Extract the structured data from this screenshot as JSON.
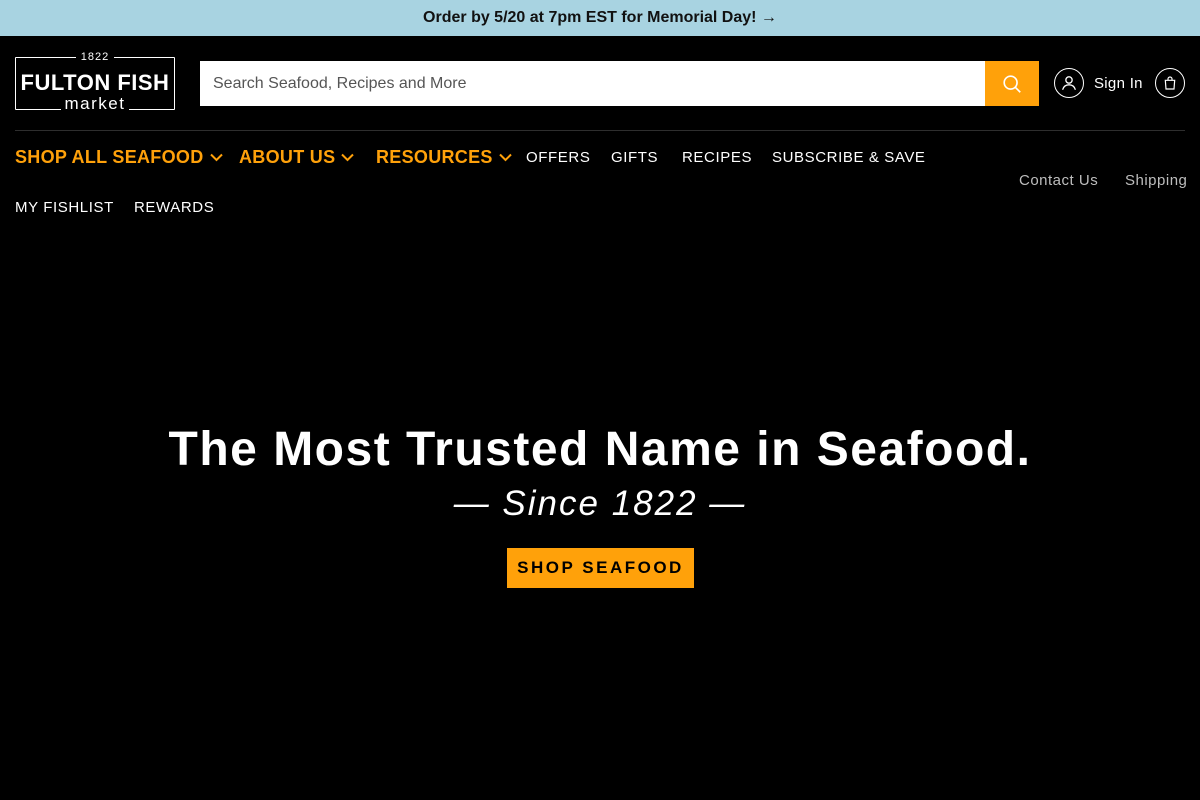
{
  "promo": {
    "text": "Order by 5/20 at 7pm EST for Memorial Day! →"
  },
  "logo": {
    "year": "1822",
    "name": "FULTON FISH",
    "sub": "market"
  },
  "search": {
    "placeholder": "Search Seafood, Recipes and More",
    "value": ""
  },
  "account": {
    "sign_in_label": "Sign In"
  },
  "nav": {
    "primary": [
      {
        "label": "SHOP ALL SEAFOOD"
      },
      {
        "label": "ABOUT US"
      },
      {
        "label": "RESOURCES"
      }
    ],
    "secondary": [
      {
        "label": "OFFERS"
      },
      {
        "label": "GIFTS"
      },
      {
        "label": "RECIPES"
      },
      {
        "label": "SUBSCRIBE & SAVE"
      },
      {
        "label": "MY FISHLIST"
      },
      {
        "label": "REWARDS"
      }
    ],
    "utility": [
      {
        "label": "Contact Us"
      },
      {
        "label": "Shipping"
      }
    ]
  },
  "hero": {
    "title": "The Most Trusted Name in Seafood.",
    "subtitle": "— Since 1822 —",
    "cta_label": "SHOP SEAFOOD"
  },
  "colors": {
    "accent": "#ffa10a",
    "promo_bg": "#a8d3e1",
    "background": "#000000"
  },
  "icons": [
    "search-icon",
    "user-icon",
    "shopping-bag-icon",
    "chevron-down-icon"
  ]
}
